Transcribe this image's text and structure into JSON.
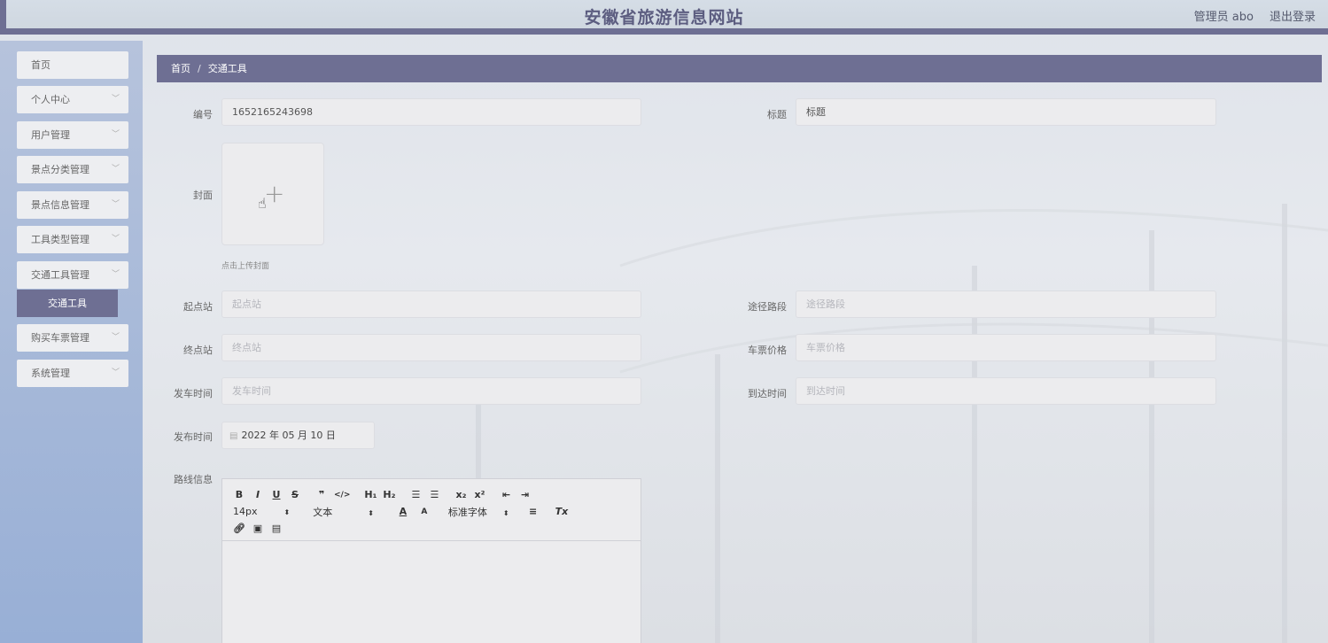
{
  "header": {
    "title": "安徽省旅游信息网站",
    "user": "管理员 abo",
    "logout": "退出登录"
  },
  "sidebar": {
    "items": [
      {
        "label": "首页",
        "has_chevron": false
      },
      {
        "label": "个人中心",
        "has_chevron": true
      },
      {
        "label": "用户管理",
        "has_chevron": true
      },
      {
        "label": "景点分类管理",
        "has_chevron": true
      },
      {
        "label": "景点信息管理",
        "has_chevron": true
      },
      {
        "label": "工具类型管理",
        "has_chevron": true
      },
      {
        "label": "交通工具管理",
        "has_chevron": true
      },
      {
        "label": "购买车票管理",
        "has_chevron": true
      },
      {
        "label": "系统管理",
        "has_chevron": true
      }
    ],
    "active_subitem": "交通工具"
  },
  "breadcrumb": {
    "home": "首页",
    "separator": "/",
    "current": "交通工具"
  },
  "form": {
    "number": {
      "label": "编号",
      "value": "1652165243698"
    },
    "title": {
      "label": "标题",
      "value": "标题"
    },
    "cover": {
      "label": "封面",
      "hint": "点击上传封面"
    },
    "start_station": {
      "label": "起点站",
      "placeholder": "起点站"
    },
    "route_section": {
      "label": "途径路段",
      "placeholder": "途径路段"
    },
    "end_station": {
      "label": "终点站",
      "placeholder": "终点站"
    },
    "ticket_price": {
      "label": "车票价格",
      "placeholder": "车票价格"
    },
    "depart_time": {
      "label": "发车时间",
      "placeholder": "发车时间"
    },
    "arrive_time": {
      "label": "到达时间",
      "placeholder": "到达时间"
    },
    "publish_time": {
      "label": "发布时间",
      "value": "2022 年 05 月 10 日"
    },
    "route_info": {
      "label": "路线信息"
    }
  },
  "editor": {
    "row1": [
      "B",
      "I",
      "U",
      "S",
      "❞",
      "</>",
      "H₁",
      "H₂",
      "☰",
      "☰",
      "x₂",
      "x²",
      "⇤",
      "⇥"
    ],
    "font_size": "14px",
    "text_type": "文本",
    "font_family": "标准字体",
    "row2_icons": [
      "A",
      "A"
    ],
    "align": "≡",
    "clear": "Tx",
    "row3": [
      "link-icon",
      "image-icon",
      "video-icon"
    ]
  },
  "colors": {
    "accent": "#6e6f93",
    "sidebar": "#a4b7d8"
  }
}
